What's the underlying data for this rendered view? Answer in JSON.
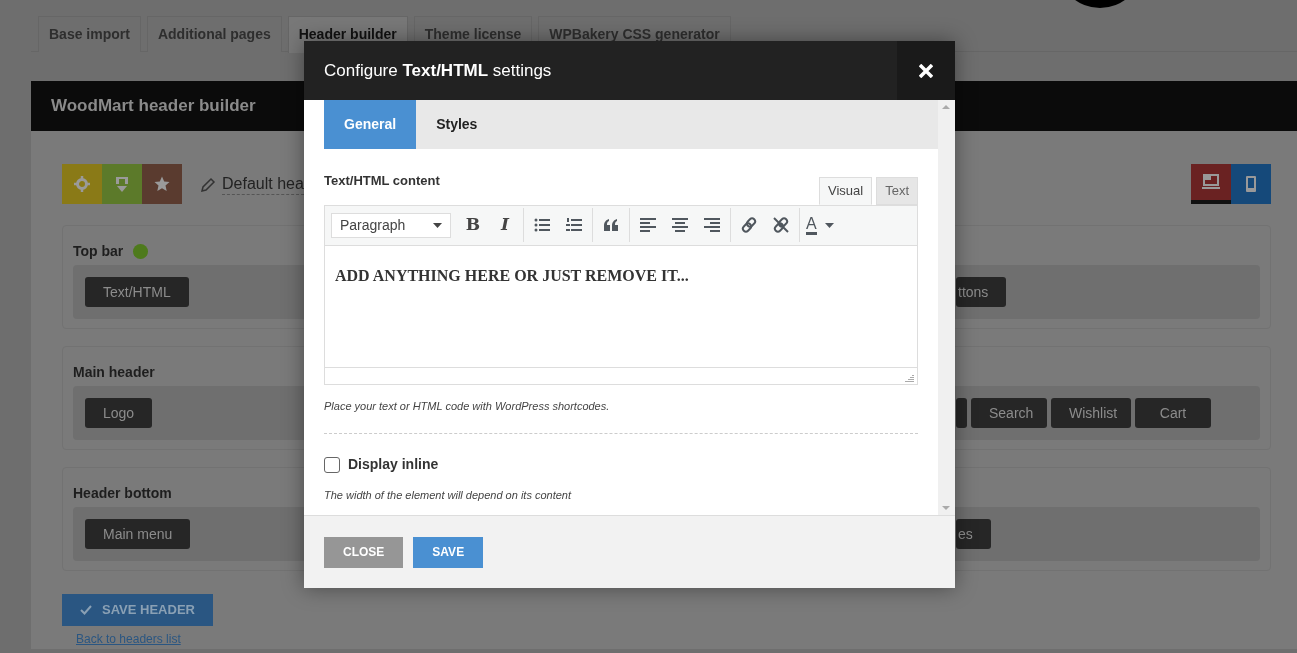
{
  "admin_tabs": [
    {
      "label": "Base import",
      "selected": false
    },
    {
      "label": "Additional pages",
      "selected": false
    },
    {
      "label": "Header builder",
      "selected": true
    },
    {
      "label": "Theme license",
      "selected": false
    },
    {
      "label": "WPBakery CSS generator",
      "selected": false
    }
  ],
  "builder": {
    "title": "WoodMart header builder",
    "header_name": "Default hea",
    "devices": [
      {
        "kind": "desktop",
        "selected": true
      },
      {
        "kind": "mobile",
        "selected": false
      }
    ],
    "rows": [
      {
        "title": "Top bar",
        "color": "#4e7a1c",
        "left_elements": [
          "Text/HTML"
        ],
        "right_elements": [
          "ttons"
        ],
        "partial_element": false
      },
      {
        "title": "Main header",
        "left_elements": [
          "Logo"
        ],
        "right_elements": [
          "Search",
          "Wishlist",
          "Cart"
        ],
        "partial_element": true
      },
      {
        "title": "Header bottom",
        "left_elements": [
          "Main menu"
        ],
        "right_elements": [
          "es"
        ],
        "partial_element": false
      }
    ],
    "save_button": "SAVE HEADER",
    "back_link": "Back to headers list"
  },
  "modal": {
    "title": "Configure **Text/HTML** settings",
    "tabs": [
      {
        "label": "General",
        "selected": true
      },
      {
        "label": "Styles",
        "selected": false
      }
    ],
    "field_label": "Text/HTML content",
    "editor_tabs": [
      {
        "label": "Visual",
        "selected": true
      },
      {
        "label": "Text",
        "selected": false
      }
    ],
    "format_select": "Paragraph",
    "bold_glyph": "B",
    "italic_glyph": "I",
    "color_glyph": "A",
    "content": "ADD ANYTHING HERE OR JUST REMOVE IT...",
    "hint": "Place your text or HTML code with WordPress shortcodes.",
    "checkbox": {
      "label": "Display inline",
      "checked": false
    },
    "checkbox_hint": "The width of the element will depend on its content",
    "buttons": [
      {
        "label": "CLOSE",
        "kind": "secondary"
      },
      {
        "label": "SAVE",
        "kind": "primary"
      }
    ]
  }
}
